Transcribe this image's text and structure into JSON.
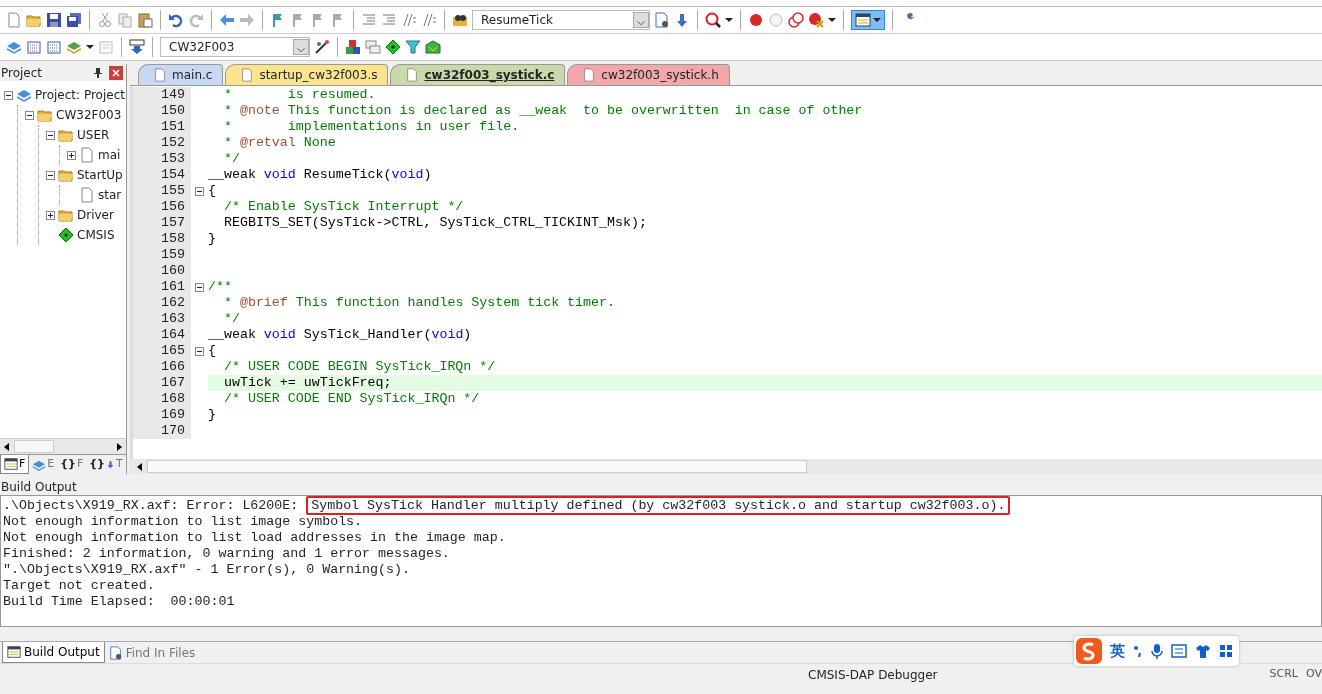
{
  "toolbar": {
    "find_combo": "ResumeTick",
    "target_combo": "CW32F003",
    "window_button": {
      "selected": true
    }
  },
  "project_panel": {
    "title": "Project",
    "tree": [
      {
        "label": "Project: Project",
        "kind": "project",
        "expanded": true,
        "children": [
          {
            "label": "CW32F003",
            "kind": "target",
            "expanded": true,
            "children": [
              {
                "label": "USER",
                "kind": "group",
                "expanded": true,
                "children": [
                  {
                    "label": "mai",
                    "kind": "file",
                    "expanded": false
                  }
                ]
              },
              {
                "label": "StartUp",
                "kind": "group",
                "expanded": true,
                "children": [
                  {
                    "label": "star",
                    "kind": "file"
                  }
                ]
              },
              {
                "label": "Driver",
                "kind": "group",
                "expanded": false
              },
              {
                "label": "CMSIS",
                "kind": "component"
              }
            ]
          }
        ]
      }
    ],
    "tabs": [
      {
        "label": "F",
        "kind": "project",
        "selected": true
      },
      {
        "label": "E",
        "kind": "books",
        "selected": false
      },
      {
        "glyph": "{}",
        "label": "F",
        "kind": "functions",
        "selected": false
      },
      {
        "glyph": "{}",
        "label": "T",
        "kind": "templates",
        "selected": false
      }
    ]
  },
  "editor": {
    "tabs": [
      {
        "label": "main.c",
        "color": "#c8d8f2",
        "selected": false
      },
      {
        "label": "startup_cw32f003.s",
        "color": "#fce48e",
        "selected": false
      },
      {
        "label": "cw32f003_systick.c",
        "color": "#c9d9aa",
        "selected": true
      },
      {
        "label": "cw32f003_systick.h",
        "color": "#f2a8a8",
        "selected": false
      }
    ],
    "lines": [
      {
        "number": "149",
        "segments": [
          {
            "text": "  *       is resumed.",
            "kind": "comment"
          }
        ]
      },
      {
        "number": "150",
        "segments": [
          {
            "text": "  * ",
            "kind": "comment"
          },
          {
            "text": "@note",
            "kind": "tag"
          },
          {
            "text": " This function is declared as __weak  to be overwritten  in case of other",
            "kind": "comment"
          }
        ]
      },
      {
        "number": "151",
        "segments": [
          {
            "text": "  *       implementations in user file.",
            "kind": "comment"
          }
        ]
      },
      {
        "number": "152",
        "segments": [
          {
            "text": "  * ",
            "kind": "comment"
          },
          {
            "text": "@retval",
            "kind": "tag"
          },
          {
            "text": " None",
            "kind": "comment"
          }
        ]
      },
      {
        "number": "153",
        "segments": [
          {
            "text": "  */",
            "kind": "comment"
          }
        ]
      },
      {
        "number": "154",
        "segments": [
          {
            "text": "__weak ",
            "kind": "plain"
          },
          {
            "text": "void",
            "kind": "keyword"
          },
          {
            "text": " ResumeTick(",
            "kind": "plain"
          },
          {
            "text": "void",
            "kind": "keyword"
          },
          {
            "text": ")",
            "kind": "plain"
          }
        ]
      },
      {
        "number": "155",
        "fold": true,
        "segments": [
          {
            "text": "{",
            "kind": "plain"
          }
        ]
      },
      {
        "number": "156",
        "segments": [
          {
            "text": "  /* Enable SysTick Interrupt */",
            "kind": "comment"
          }
        ]
      },
      {
        "number": "157",
        "segments": [
          {
            "text": "  REGBITS_SET(SysTick->CTRL, SysTick_CTRL_TICKINT_Msk);",
            "kind": "plain"
          }
        ]
      },
      {
        "number": "158",
        "segments": [
          {
            "text": "}",
            "kind": "plain"
          }
        ]
      },
      {
        "number": "159"
      },
      {
        "number": "160"
      },
      {
        "number": "161",
        "fold": true,
        "segments": [
          {
            "text": "/**",
            "kind": "comment"
          }
        ]
      },
      {
        "number": "162",
        "segments": [
          {
            "text": "  * ",
            "kind": "comment"
          },
          {
            "text": "@brief",
            "kind": "tag"
          },
          {
            "text": " This function handles System tick timer.",
            "kind": "comment"
          }
        ]
      },
      {
        "number": "163",
        "segments": [
          {
            "text": "  */",
            "kind": "comment"
          }
        ]
      },
      {
        "number": "164",
        "segments": [
          {
            "text": "__weak ",
            "kind": "plain"
          },
          {
            "text": "void",
            "kind": "keyword"
          },
          {
            "text": " SysTick_Handler(",
            "kind": "plain"
          },
          {
            "text": "void",
            "kind": "keyword"
          },
          {
            "text": ")",
            "kind": "plain"
          }
        ]
      },
      {
        "number": "165",
        "fold": true,
        "segments": [
          {
            "text": "{",
            "kind": "plain"
          }
        ]
      },
      {
        "number": "166",
        "segments": [
          {
            "text": "  /* USER CODE BEGIN SysTick_IRQn */",
            "kind": "comment"
          }
        ]
      },
      {
        "number": "167",
        "current": true,
        "segments": [
          {
            "text": "  uwTick += uwTickFreq;",
            "kind": "plain"
          }
        ]
      },
      {
        "number": "168",
        "segments": [
          {
            "text": "  /* USER CODE END SysTick_IRQn */",
            "kind": "comment"
          }
        ]
      },
      {
        "number": "169",
        "segments": [
          {
            "text": "}",
            "kind": "plain"
          }
        ]
      },
      {
        "number": "170"
      }
    ]
  },
  "build_output": {
    "title": "Build Output",
    "lines": [
      {
        "text": ".\\Objects\\X919_RX.axf: Error: L6200E: ",
        "boxed": "Symbol SysTick Handler multiply defined (by cw32f003 systick.o and startup cw32f003.o)."
      },
      {
        "text": "Not enough information to list image symbols."
      },
      {
        "text": "Not enough information to list load addresses in the image map."
      },
      {
        "text": "Finished: 2 information, 0 warning and 1 error messages."
      },
      {
        "text": "\".\\Objects\\X919_RX.axf\" - 1 Error(s), 0 Warning(s)."
      },
      {
        "text": "Target not created."
      },
      {
        "text": "Build Time Elapsed:  00:00:01"
      }
    ]
  },
  "bottom_tabs": [
    {
      "label": "Build Output",
      "kind": "build",
      "selected": true
    },
    {
      "label": "Find In Files",
      "kind": "find",
      "selected": false
    }
  ],
  "status_bar": {
    "debugger": "CMSIS-DAP Debugger",
    "indicators": [
      "SCRL",
      "OV"
    ]
  },
  "ime_bar": {
    "mode": "英"
  }
}
